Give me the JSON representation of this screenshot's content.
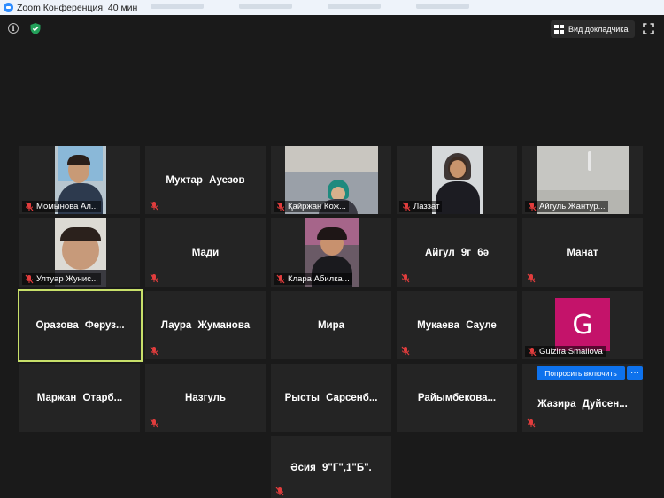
{
  "window": {
    "title": "Zoom Конференция, 40 мин"
  },
  "toolbar": {
    "speaker_view_label": "Вид докладчика"
  },
  "tiles": {
    "t1": "Момынова Ал...",
    "t2": "Мухтар Ауезов",
    "t3": "Қайржан Кож...",
    "t4": "Лаззат",
    "t5": "Айгуль Жантур...",
    "t6": "Ултуар Жунис...",
    "t7": "Мади",
    "t8": "Клара Абилка...",
    "t9": "Айгул 9г 6ә",
    "t10": "Манат",
    "t11": "Оразова Феруз...",
    "t12": "Лаура Жуманова",
    "t13": "Мира",
    "t14": "Мукаева Сауле",
    "t15": "Gulzira Smailova",
    "t15_initial": "G",
    "t16": "Маржан Отарб...",
    "t17": "Назгуль",
    "t18": "Рысты Сарсенб...",
    "t19": "Райымбекова...",
    "t20": "Жазира Дуйсен...",
    "t21": "Әсия 9\"Г\",1\"Б\"."
  },
  "actions": {
    "ask_unmute": "Попросить включить",
    "more": "···"
  },
  "colors": {
    "active_border": "#c8e06a",
    "muted_icon": "#e23d3d",
    "accent": "#0e72ed",
    "avatar_bg": "#c4136a"
  }
}
